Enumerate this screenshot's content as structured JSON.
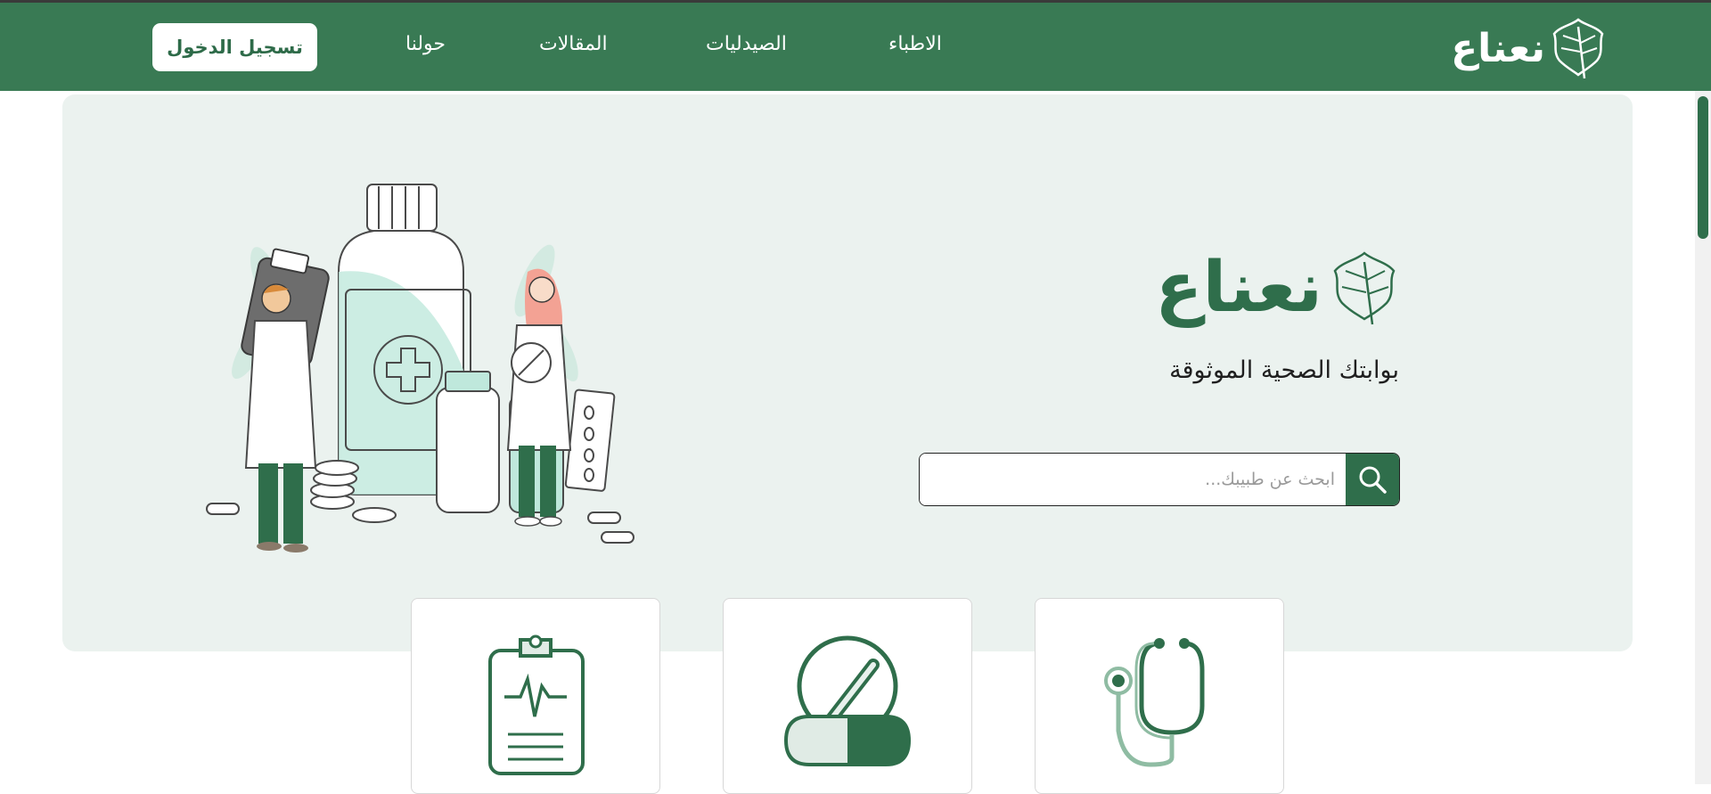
{
  "brand": {
    "name": "نعناع"
  },
  "nav": {
    "links": [
      {
        "label": "الاطباء"
      },
      {
        "label": "الصيدليات"
      },
      {
        "label": "المقالات"
      },
      {
        "label": "حولنا"
      }
    ],
    "login_label": "تسجيل الدخول"
  },
  "hero": {
    "title": "نعناع",
    "tagline": "بوابتك الصحية الموثوقة",
    "search": {
      "placeholder": "ابحث عن طبيبك..."
    }
  },
  "cards": [
    {
      "icon": "stethoscope-icon"
    },
    {
      "icon": "pills-icon"
    },
    {
      "icon": "clipboard-icon"
    }
  ],
  "colors": {
    "primary": "#397a54",
    "hero_bg": "#ebf2ef",
    "accent_mint": "#bfe8dc"
  }
}
